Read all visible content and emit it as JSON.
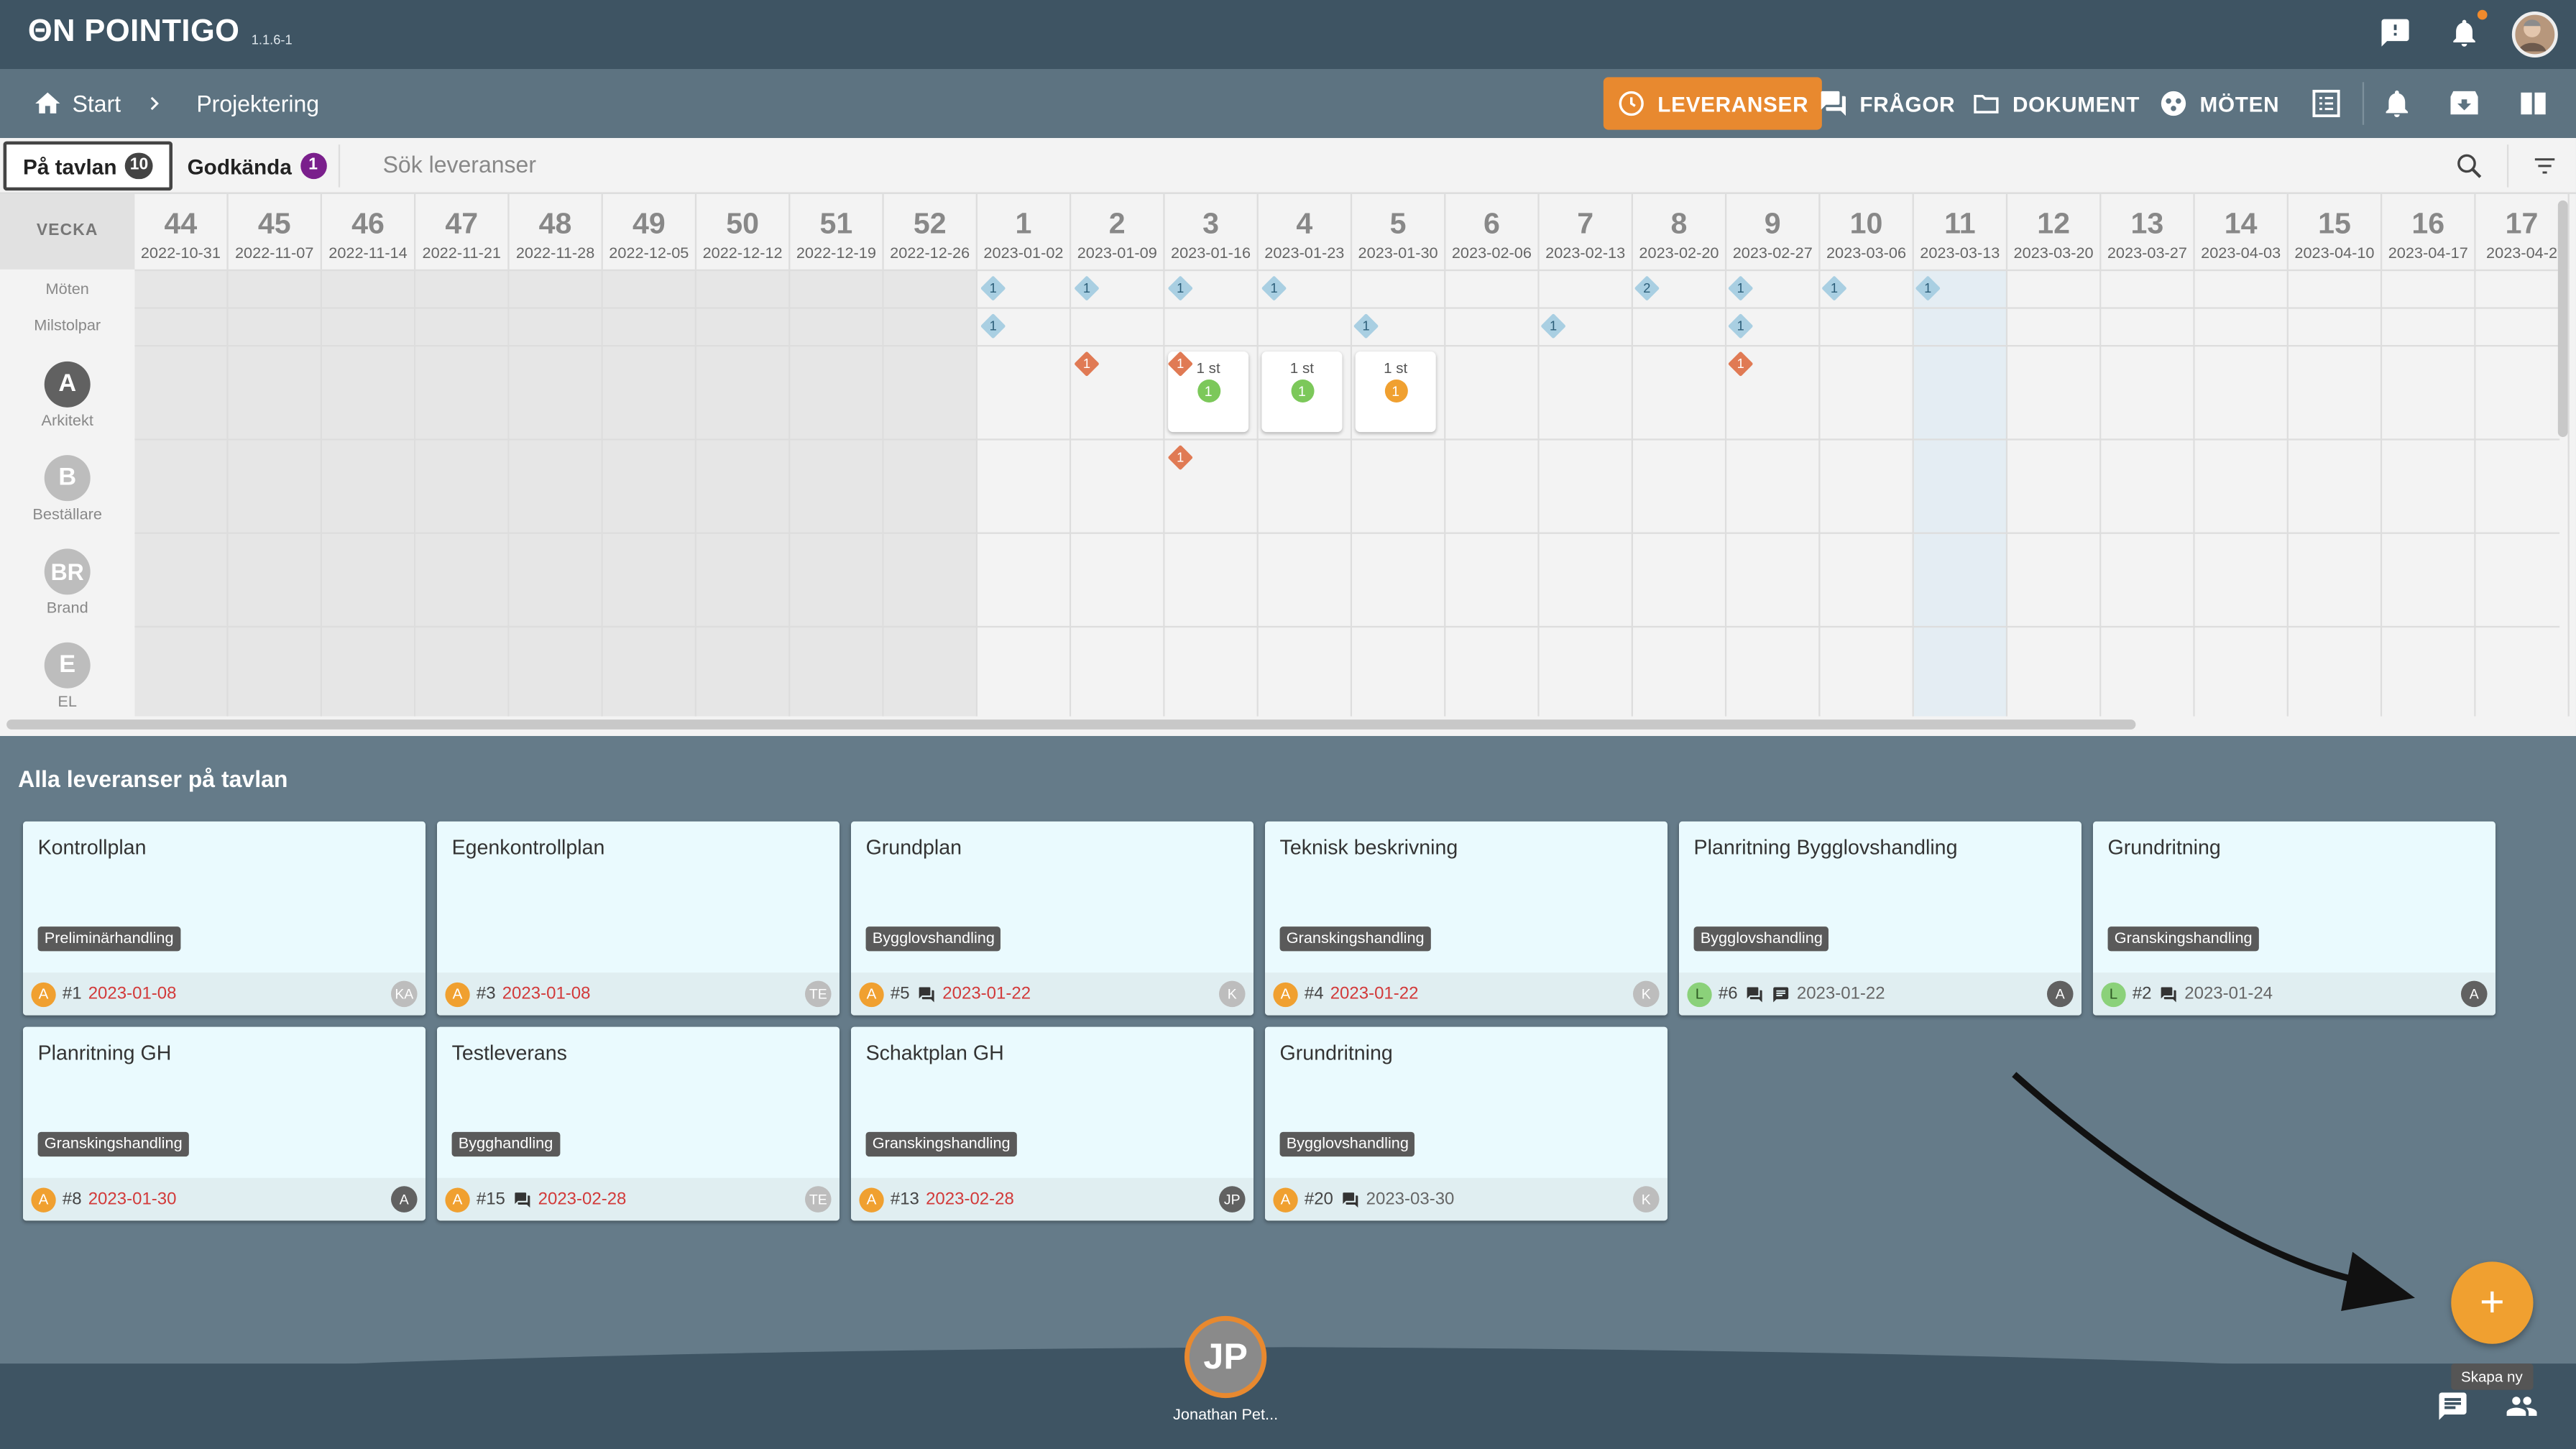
{
  "app": {
    "logo": "ΘN POINTIGO",
    "version": "1.1.6-1"
  },
  "nav": {
    "breadcrumb": [
      {
        "label": "Start"
      },
      {
        "label": "Projektering"
      }
    ],
    "buttons": {
      "leveranser": "LEVERANSER",
      "fragor": "FRÅGOR",
      "dokument": "DOKUMENT",
      "moten": "MÖTEN"
    }
  },
  "tabs": [
    {
      "label": "På tavlan",
      "count": "10"
    },
    {
      "label": "Godkända",
      "count": "1"
    }
  ],
  "search": {
    "placeholder": "Sök leveranser"
  },
  "calendar": {
    "header_label": "VECKA",
    "weeks": [
      {
        "num": "44",
        "date": "2022-10-31"
      },
      {
        "num": "45",
        "date": "2022-11-07"
      },
      {
        "num": "46",
        "date": "2022-11-14"
      },
      {
        "num": "47",
        "date": "2022-11-21"
      },
      {
        "num": "48",
        "date": "2022-11-28"
      },
      {
        "num": "49",
        "date": "2022-12-05"
      },
      {
        "num": "50",
        "date": "2022-12-12"
      },
      {
        "num": "51",
        "date": "2022-12-19"
      },
      {
        "num": "52",
        "date": "2022-12-26"
      },
      {
        "num": "1",
        "date": "2023-01-02"
      },
      {
        "num": "2",
        "date": "2023-01-09"
      },
      {
        "num": "3",
        "date": "2023-01-16"
      },
      {
        "num": "4",
        "date": "2023-01-23"
      },
      {
        "num": "5",
        "date": "2023-01-30"
      },
      {
        "num": "6",
        "date": "2023-02-06"
      },
      {
        "num": "7",
        "date": "2023-02-13"
      },
      {
        "num": "8",
        "date": "2023-02-20"
      },
      {
        "num": "9",
        "date": "2023-02-27"
      },
      {
        "num": "10",
        "date": "2023-03-06"
      },
      {
        "num": "11",
        "date": "2023-03-13"
      },
      {
        "num": "12",
        "date": "2023-03-20"
      },
      {
        "num": "13",
        "date": "2023-03-27"
      },
      {
        "num": "14",
        "date": "2023-04-03"
      },
      {
        "num": "15",
        "date": "2023-04-10"
      },
      {
        "num": "16",
        "date": "2023-04-17"
      },
      {
        "num": "17",
        "date": "2023-04-2"
      }
    ],
    "rows": {
      "moten": "Möten",
      "milstolpar": "Milstolpar",
      "participants": [
        {
          "initial": "A",
          "name": "Arkitekt",
          "color": "#616161"
        },
        {
          "initial": "B",
          "name": "Beställare",
          "color": "#bdbdbd"
        },
        {
          "initial": "BR",
          "name": "Brand",
          "color": "#bdbdbd"
        },
        {
          "initial": "E",
          "name": "EL",
          "color": "#bdbdbd"
        }
      ]
    },
    "moten_markers": [
      "1",
      "1",
      "1",
      "1",
      "2",
      "1",
      "1",
      "1"
    ],
    "milstolpar_markers": [
      "1",
      "1",
      "1",
      "1"
    ],
    "arkitekt_markers": [
      "1",
      "1",
      "1"
    ],
    "bestallare_markers": [
      "1"
    ],
    "deliveries": [
      {
        "label": "1 st",
        "count": "1",
        "color": "#7cc85a"
      },
      {
        "label": "1 st",
        "count": "1",
        "color": "#7cc85a"
      },
      {
        "label": "1 st",
        "count": "1",
        "color": "#f0a030"
      }
    ]
  },
  "list": {
    "title": "Alla leveranser på tavlan",
    "cards": [
      {
        "title": "Kontrollplan",
        "tag": "Preliminärhandling",
        "role": "A",
        "num": "#1",
        "date": "2023-01-08",
        "initials": "KA",
        "date_red": true,
        "chat": false,
        "doc": false
      },
      {
        "title": "Egenkontrollplan",
        "tag": "",
        "role": "A",
        "num": "#3",
        "date": "2023-01-08",
        "initials": "TE",
        "date_red": true,
        "chat": false,
        "doc": false
      },
      {
        "title": "Grundplan",
        "tag": "Bygglovshandling",
        "role": "A",
        "num": "#5",
        "date": "2023-01-22",
        "initials": "K",
        "date_red": true,
        "chat": true,
        "doc": false
      },
      {
        "title": "Teknisk beskrivning",
        "tag": "Granskingshandling",
        "role": "A",
        "num": "#4",
        "date": "2023-01-22",
        "initials": "K",
        "date_red": true,
        "chat": false,
        "doc": false
      },
      {
        "title": "Planritning Bygglovshandling",
        "tag": "Bygglovshandling",
        "role": "L",
        "num": "#6",
        "date": "2023-01-22",
        "initials": "A",
        "date_red": false,
        "chat": true,
        "doc": true
      },
      {
        "title": "Grundritning",
        "tag": "Granskingshandling",
        "role": "L",
        "num": "#2",
        "date": "2023-01-24",
        "initials": "A",
        "date_red": false,
        "chat": true,
        "doc": false
      },
      {
        "title": "Planritning GH",
        "tag": "Granskingshandling",
        "role": "A",
        "num": "#8",
        "date": "2023-01-30",
        "initials": "A",
        "date_red": true,
        "chat": false,
        "doc": false
      },
      {
        "title": "Testleverans",
        "tag": "Bygghandling",
        "role": "A",
        "num": "#15",
        "date": "2023-02-28",
        "initials": "TE",
        "date_red": true,
        "chat": true,
        "doc": false
      },
      {
        "title": "Schaktplan GH",
        "tag": "Granskingshandling",
        "role": "A",
        "num": "#13",
        "date": "2023-02-28",
        "initials": "JP",
        "date_red": true,
        "chat": false,
        "doc": false
      },
      {
        "title": "Grundritning",
        "tag": "Bygglovshandling",
        "role": "A",
        "num": "#20",
        "date": "2023-03-30",
        "initials": "K",
        "date_red": false,
        "chat": true,
        "doc": false
      }
    ]
  },
  "user": {
    "initials": "JP",
    "name": "Jonathan Pet..."
  },
  "fab": {
    "symbol": "+",
    "tooltip": "Skapa ny"
  },
  "colors": {
    "accent": "#e8892f",
    "header": "#3e5463",
    "nav": "#5d7381"
  }
}
